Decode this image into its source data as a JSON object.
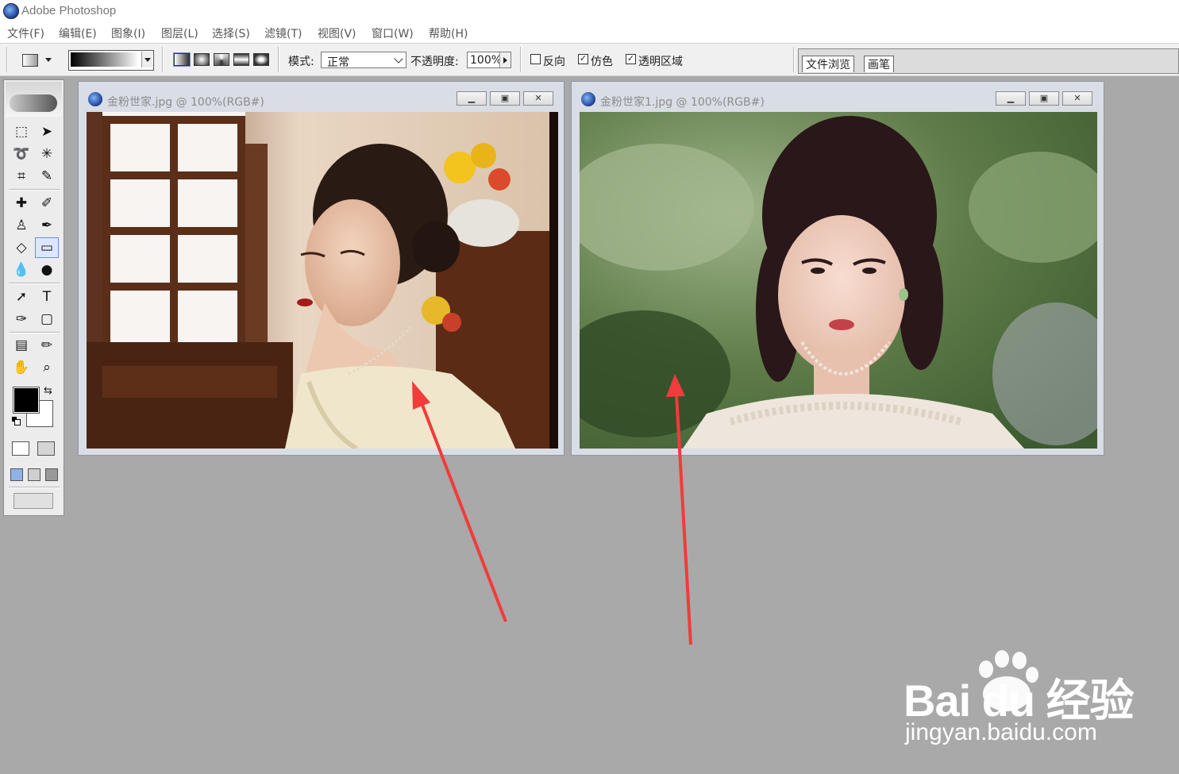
{
  "app": {
    "title": "Adobe Photoshop"
  },
  "menu": [
    "文件(F)",
    "编辑(E)",
    "图象(I)",
    "图层(L)",
    "选择(S)",
    "滤镜(T)",
    "视图(V)",
    "窗口(W)",
    "帮助(H)"
  ],
  "options": {
    "mode_label": "模式:",
    "mode_value": "正常",
    "opacity_label": "不透明度:",
    "opacity_value": "100%",
    "reverse_label": "反向",
    "dither_label": "仿色",
    "transparency_label": "透明区域",
    "reverse_checked": false,
    "dither_checked": true,
    "transparency_checked": true
  },
  "palette_well": {
    "tabs": [
      "文件浏览",
      "画笔"
    ]
  },
  "documents": [
    {
      "title": "金粉世家.jpg @ 100%(RGB#)"
    },
    {
      "title": "金粉世家1.jpg @ 100%(RGB#)"
    }
  ],
  "watermark": {
    "brand": "Bai du 经验",
    "url": "jingyan.baidu.com"
  },
  "colors": {
    "arrow": "#f23b3b",
    "workspace": "#a9a9a9",
    "foreground": "#000000",
    "background": "#ffffff"
  }
}
